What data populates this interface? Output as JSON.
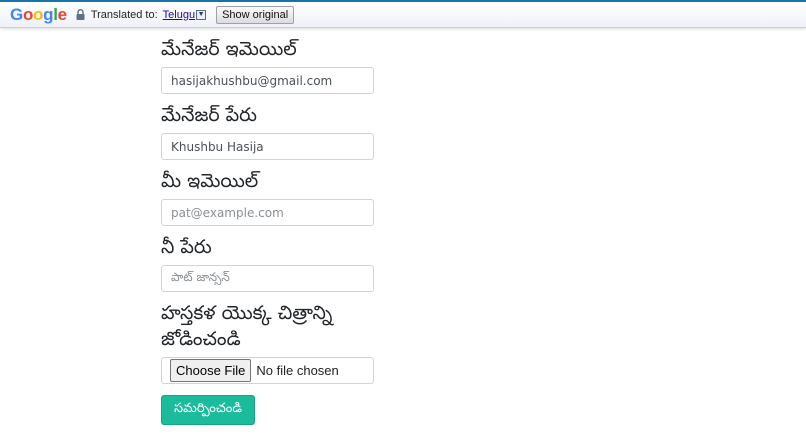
{
  "translate_bar": {
    "logo_letters": [
      "G",
      "o",
      "o",
      "g",
      "l",
      "e"
    ],
    "translated_to_label": "Translated to:",
    "language": "Telugu",
    "dropdown_glyph": "▼",
    "show_original_label": "Show original"
  },
  "form": {
    "manager_email": {
      "label": "మేనేజర్ ఇమెయిల్",
      "value": "hasijakhushbu@gmail.com"
    },
    "manager_name": {
      "label": "మేనేజర్ పేరు",
      "value": "Khushbu Hasija"
    },
    "your_email": {
      "label": "మీ ఇమెయిల్",
      "placeholder": "pat@example.com"
    },
    "your_name": {
      "label": "నీ పేరు",
      "placeholder": "పాట్ జాన్సన్"
    },
    "craft_image": {
      "label": "హస్తకళ యొక్క చిత్రాన్ని జోడించండి",
      "choose_file_label": "Choose File",
      "status": "No file chosen"
    },
    "submit_label": "సమర్పించండి"
  },
  "colors": {
    "submit_bg": "#1abc9c",
    "link": "#1a0dab"
  }
}
